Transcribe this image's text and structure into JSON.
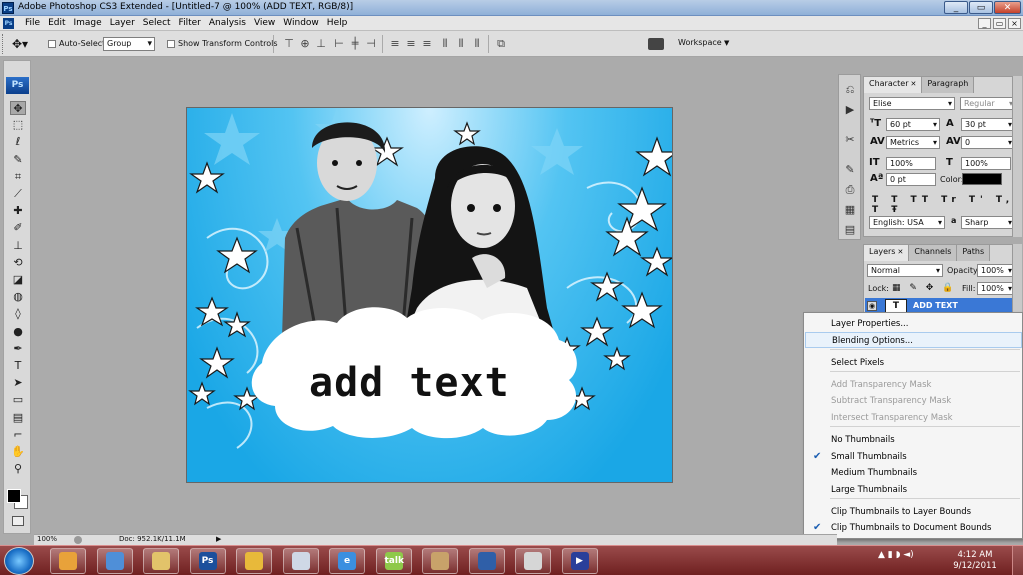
{
  "window": {
    "title": "Adobe Photoshop CS3 Extended - [Untitled-7 @ 100% (ADD TEXT, RGB/8)]",
    "app_badge": "Ps",
    "min_label": "_",
    "max_label": "▭",
    "close_label": "✕"
  },
  "menubar": {
    "items": [
      "File",
      "Edit",
      "Image",
      "Layer",
      "Select",
      "Filter",
      "Analysis",
      "View",
      "Window",
      "Help"
    ],
    "doc_min": "_",
    "doc_restore": "▭",
    "doc_close": "×"
  },
  "options": {
    "auto_select_label": "Auto-Select:",
    "auto_select_value": "Group",
    "show_transform_label": "Show Transform Controls",
    "workspace_label": "Workspace"
  },
  "toolbox": {
    "logo": "Ps",
    "tools": [
      {
        "name": "move-tool",
        "glyph": "✥"
      },
      {
        "name": "marquee-tool",
        "glyph": "⬚"
      },
      {
        "name": "lasso-tool",
        "glyph": "ℓ"
      },
      {
        "name": "quick-select-tool",
        "glyph": "✎"
      },
      {
        "name": "crop-tool",
        "glyph": "⌗"
      },
      {
        "name": "slice-tool",
        "glyph": "⟋"
      },
      {
        "name": "healing-brush-tool",
        "glyph": "✚"
      },
      {
        "name": "brush-tool",
        "glyph": "✐"
      },
      {
        "name": "clone-stamp-tool",
        "glyph": "⊥"
      },
      {
        "name": "history-brush-tool",
        "glyph": "⟲"
      },
      {
        "name": "eraser-tool",
        "glyph": "◪"
      },
      {
        "name": "paint-bucket-tool",
        "glyph": "◍"
      },
      {
        "name": "blur-tool",
        "glyph": "◊"
      },
      {
        "name": "dodge-tool",
        "glyph": "●"
      },
      {
        "name": "pen-tool",
        "glyph": "✒"
      },
      {
        "name": "type-tool",
        "glyph": "T"
      },
      {
        "name": "path-select-tool",
        "glyph": "➤"
      },
      {
        "name": "shape-tool",
        "glyph": "▭"
      },
      {
        "name": "notes-tool",
        "glyph": "▤"
      },
      {
        "name": "eyedropper-tool",
        "glyph": "⌐"
      },
      {
        "name": "hand-tool",
        "glyph": "✋"
      },
      {
        "name": "zoom-tool",
        "glyph": "⚲"
      }
    ]
  },
  "canvas": {
    "overlay_text": "add text"
  },
  "character_panel": {
    "tabs": [
      "Character",
      "Paragraph"
    ],
    "font_family": "Elise",
    "font_style": "Regular",
    "font_size": "60 pt",
    "leading": "30 pt",
    "kerning": "Metrics",
    "tracking": "0",
    "vertical_scale": "100%",
    "horizontal_scale": "100%",
    "baseline_shift": "0 pt",
    "color_label": "Color:",
    "language": "English: USA",
    "anti_alias_label": "a",
    "anti_alias": "Sharp"
  },
  "layers_panel": {
    "tabs": [
      "Layers",
      "Channels",
      "Paths"
    ],
    "blend_mode": "Normal",
    "opacity_label": "Opacity:",
    "opacity": "100%",
    "lock_label": "Lock:",
    "fill_label": "Fill:",
    "fill": "100%",
    "layer_name": "ADD TEXT",
    "layer_thumb": "T"
  },
  "context_menu": {
    "items": [
      {
        "label": "Layer Properties...",
        "disabled": false,
        "checked": false,
        "highlighted": false
      },
      {
        "label": "Blending Options...",
        "disabled": false,
        "checked": false,
        "highlighted": true
      },
      {
        "label": "Select Pixels",
        "disabled": false,
        "checked": false,
        "highlighted": false
      },
      {
        "label": "Add Transparency Mask",
        "disabled": true,
        "checked": false,
        "highlighted": false
      },
      {
        "label": "Subtract Transparency Mask",
        "disabled": true,
        "checked": false,
        "highlighted": false
      },
      {
        "label": "Intersect Transparency Mask",
        "disabled": true,
        "checked": false,
        "highlighted": false
      },
      {
        "label": "No Thumbnails",
        "disabled": false,
        "checked": false,
        "highlighted": false
      },
      {
        "label": "Small Thumbnails",
        "disabled": false,
        "checked": true,
        "highlighted": false
      },
      {
        "label": "Medium Thumbnails",
        "disabled": false,
        "checked": false,
        "highlighted": false
      },
      {
        "label": "Large Thumbnails",
        "disabled": false,
        "checked": false,
        "highlighted": false
      },
      {
        "label": "Clip Thumbnails to Layer Bounds",
        "disabled": false,
        "checked": false,
        "highlighted": false
      },
      {
        "label": "Clip Thumbnails to Document Bounds",
        "disabled": false,
        "checked": true,
        "highlighted": false
      }
    ],
    "check_glyph": "✔"
  },
  "statusbar": {
    "zoom": "100%",
    "doc_info": "Doc: 952.1K/11.1M",
    "arrow": "▶"
  },
  "taskbar": {
    "buttons": [
      {
        "name": "windows-media-button",
        "label": ""
      },
      {
        "name": "itunes-button",
        "label": ""
      },
      {
        "name": "explorer-button",
        "label": ""
      },
      {
        "name": "photoshop-taskbar-button",
        "label": "Ps"
      },
      {
        "name": "chrome-button",
        "label": ""
      },
      {
        "name": "notes-button",
        "label": ""
      },
      {
        "name": "internet-explorer-button",
        "label": "e"
      },
      {
        "name": "google-talk-button",
        "label": "talk"
      },
      {
        "name": "video-editor-button",
        "label": ""
      },
      {
        "name": "app-button",
        "label": ""
      },
      {
        "name": "paint-button",
        "label": ""
      },
      {
        "name": "media-player-button",
        "label": "▶"
      }
    ],
    "time": "4:12 AM",
    "date": "9/12/2011",
    "tray_icons": "▲ ▮ ◗ ◄)"
  },
  "colors": {
    "taskbar": "#7a2a2a",
    "canvas_sky": "#1aa7e6",
    "menu_highlight": "#e9f2fb",
    "check": "#1c5fb2"
  }
}
